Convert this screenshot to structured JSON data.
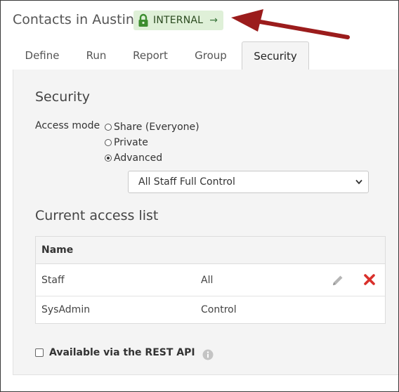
{
  "header": {
    "title": "Contacts in Austin",
    "badge_label": "INTERNAL",
    "badge_icon": "lock-icon",
    "badge_arrow": "→",
    "badge_color": "#dff0d8",
    "annotation_color": "#9b1c1c"
  },
  "tabs": [
    {
      "label": "Define",
      "active": false
    },
    {
      "label": "Run",
      "active": false
    },
    {
      "label": "Report",
      "active": false
    },
    {
      "label": "Group",
      "active": false
    },
    {
      "label": "Security",
      "active": true
    }
  ],
  "security": {
    "heading": "Security",
    "access_mode_label": "Access mode",
    "options": [
      {
        "label": "Share (Everyone)",
        "checked": false
      },
      {
        "label": "Private",
        "checked": false
      },
      {
        "label": "Advanced",
        "checked": true
      }
    ],
    "advanced_select_value": "All Staff Full Control"
  },
  "access_list": {
    "heading": "Current access list",
    "column_header": "Name",
    "rows": [
      {
        "name": "Staff",
        "access": "All",
        "editable": true
      },
      {
        "name": "SysAdmin",
        "access": "Control",
        "editable": false
      }
    ],
    "delete_color": "#d9302b"
  },
  "rest_api": {
    "label": "Available via the REST API",
    "checked": false
  }
}
